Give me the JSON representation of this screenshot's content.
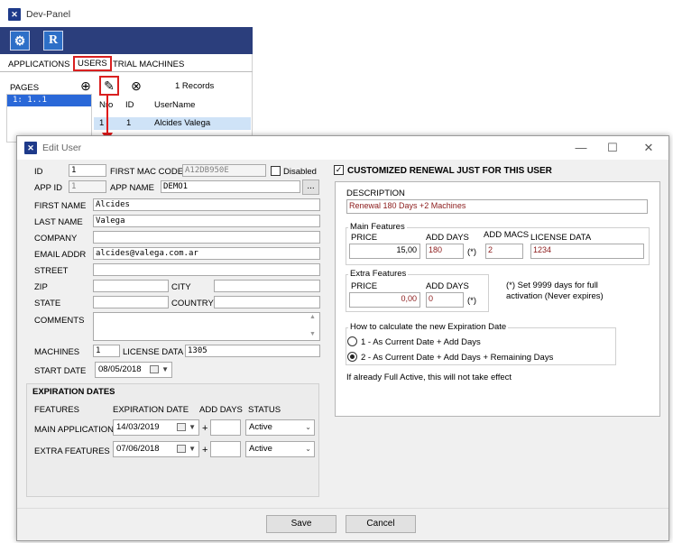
{
  "devpanel": {
    "title": "Dev-Panel",
    "toolbar_btn_r": "R",
    "tabs": [
      "APPLICATIONS",
      "USERS",
      "TRIAL MACHINES"
    ],
    "pages_label": "PAGES",
    "pages_row": "1:     1..1",
    "records": "1 Records",
    "grid": {
      "headers": [
        "Nro",
        "ID",
        "UserName"
      ],
      "row": [
        "1",
        "1",
        "Alcides Valega"
      ]
    }
  },
  "dialog": {
    "title": "Edit User",
    "win_min": "—",
    "win_max": "☐",
    "win_close": "✕",
    "left": {
      "id_label": "ID",
      "id_value": "1",
      "first_mac_label": "FIRST MAC CODE",
      "first_mac_value": "A12DB950E",
      "disabled_label": "Disabled",
      "app_id_label": "APP ID",
      "app_id_value": "1",
      "app_name_label": "APP NAME",
      "app_name_value": "DEMO1",
      "browse_label": "...",
      "first_name_label": "FIRST NAME",
      "first_name_value": "Alcides",
      "last_name_label": "LAST NAME",
      "last_name_value": "Valega",
      "company_label": "COMPANY",
      "company_value": "",
      "email_label": "EMAIL ADDR",
      "email_value": "alcides@valega.com.ar",
      "street_label": "STREET",
      "street_value": "",
      "zip_label": "ZIP",
      "zip_value": "",
      "city_label": "CITY",
      "city_value": "",
      "state_label": "STATE",
      "state_value": "",
      "country_label": "COUNTRY",
      "country_value": "",
      "comments_label": "COMMENTS",
      "comments_value": "",
      "machines_label": "MACHINES",
      "machines_value": "1",
      "license_data_label": "LICENSE DATA",
      "license_data_value": "1305",
      "start_date_label": "START DATE",
      "start_date_value": "08/05/2018"
    },
    "expiration": {
      "section_title": "EXPIRATION DATES",
      "col_features": "FEATURES",
      "col_exp_date": "EXPIRATION DATE",
      "col_add_days": "ADD DAYS",
      "col_status": "STATUS",
      "plus": "+",
      "rows": [
        {
          "feature": "MAIN APPLICATION",
          "date": "14/03/2019",
          "add_days": "",
          "status": "Active"
        },
        {
          "feature": "EXTRA FEATURES",
          "date": "07/06/2018",
          "add_days": "",
          "status": "Active"
        }
      ]
    },
    "right": {
      "custom_renewal_label": "CUSTOMIZED RENEWAL JUST FOR THIS USER",
      "description_label": "DESCRIPTION",
      "description_value": "Renewal 180 Days +2 Machines",
      "main_features_label": "Main Features",
      "price_label": "PRICE",
      "price_value": "15,00",
      "add_days_label": "ADD DAYS",
      "add_days_value": "180",
      "asterisk": "(*)",
      "add_macs_label": "ADD MACS",
      "add_macs_value": "2",
      "license_data_label": "LICENSE DATA",
      "license_data_value": "1234",
      "extra_features_label": "Extra Features",
      "extra_price_label": "PRICE",
      "extra_price_value": "0,00",
      "extra_add_days_label": "ADD DAYS",
      "extra_add_days_value": "0",
      "extra_asterisk": "(*)",
      "note_line1": "(*) Set 9999 days for full",
      "note_line2": "activation (Never expires)",
      "calc_group_label": "How to calculate the new Expiration Date",
      "option1": "1 - As Current Date + Add Days",
      "option2": "2 - As Current Date + Add Days + Remaining Days",
      "full_active_note": "If already Full Active, this will not take effect"
    },
    "save_label": "Save",
    "cancel_label": "Cancel"
  }
}
